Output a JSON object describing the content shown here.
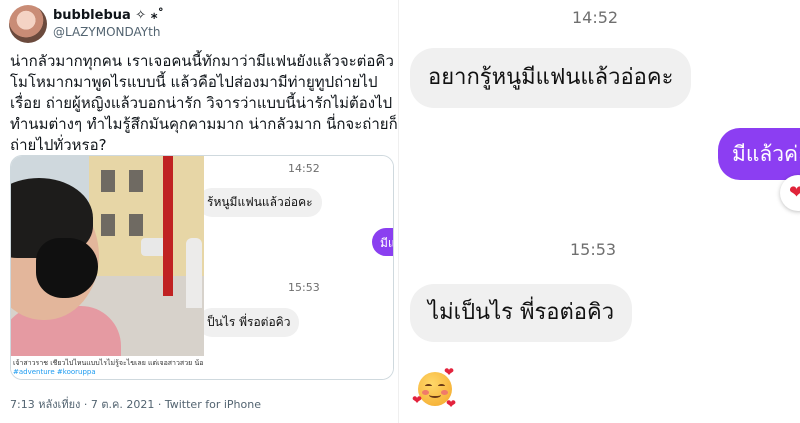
{
  "tweet": {
    "display_name": "bubblebua ✧ ⁎˚",
    "handle": "@LAZYMONDAYth",
    "text_lines": [
      "น่ากลัวมากทุกคน เราเจอคนนี้ทักมาว่ามีแฟนยังแล้วจะต่อคิว",
      "โมโหมากมาพูดไรแบบนี้ แล้วคือไปส่องมามีท่ายูทูปถ่ายไป",
      "เรื่อย ถ่ายผู้หญิงแล้วบอกน่ารัก วิจารว่าแบบนี้น่ารักไม่ต้องไป",
      "ทำนมต่างๆ ทำไมรู้สึกมันคุกคามมาก น่ากลัวมาก นี่กจะถ่ายก็",
      "ถ่ายไปทั่วหรอ?"
    ],
    "photo_caption": "เจ้าสาวราช เชียวไปไหนแบบไรไม่รู้จะไขเลย แต่เจอสาวสวย น้องเค้ากำ",
    "photo_hashtags": "#adventure #kooruppa",
    "meta": "7:13 หลังเที่ยง · 7 ต.ค. 2021 · Twitter for iPhone",
    "mini_chat": {
      "time1": "14:52",
      "bubble1": "ร้หนูมีแฟนแล้วอ่อคะ",
      "sent": "มีแล",
      "time2": "15:53",
      "bubble2": "ป็นไร  พี่รอต่อคิว"
    }
  },
  "chat": {
    "time1": "14:52",
    "received1": "อยากรู้หนูมีแฟนแล้วอ่อคะ",
    "sent1": "มีแล้วค่ะ",
    "reaction": "❤",
    "time2": "15:53",
    "received2": "ไม่เป็นไร  พี่รอต่อคิว",
    "sticker_hearts": [
      "❤",
      "❤",
      "❤"
    ]
  },
  "colors": {
    "sent_bubble": "#8c3ef2",
    "received_bubble": "#f0f0f0",
    "heart": "#e0243a"
  },
  "icons": [
    "avatar-photo",
    "heart-reaction-icon",
    "smiling-face-with-hearts-emoji"
  ]
}
